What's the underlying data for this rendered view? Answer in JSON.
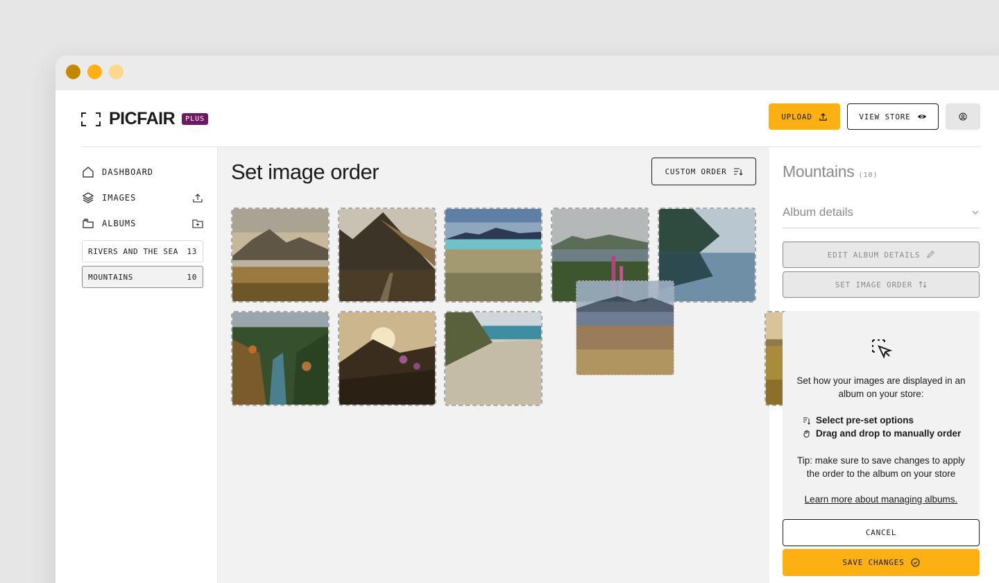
{
  "window": {
    "traffic_lights": [
      "#c48800",
      "#fdb013",
      "#fdd88a"
    ]
  },
  "brand": {
    "name": "PICFAIR",
    "badge": "PLUS",
    "badge_color": "#6d1a63",
    "accent": "#fdb013"
  },
  "header": {
    "upload_label": "UPLOAD",
    "view_store_label": "VIEW STORE"
  },
  "sidebar": {
    "nav": [
      {
        "label": "DASHBOARD",
        "icon": "home-icon"
      },
      {
        "label": "IMAGES",
        "icon": "layers-icon",
        "action_icon": "upload-icon"
      },
      {
        "label": "ALBUMS",
        "icon": "folder-icon",
        "action_icon": "folder-plus-icon"
      }
    ],
    "albums": [
      {
        "name": "RIVERS AND THE SEA",
        "count": "13",
        "active": false
      },
      {
        "name": "MOUNTAINS",
        "count": "10",
        "active": true
      }
    ]
  },
  "main": {
    "title": "Set image order",
    "order_button": "CUSTOM ORDER",
    "images": [
      "mountain-lake-highlands",
      "mountain-valley-path",
      "coastal-dunes-mountains",
      "foxgloves-lake",
      "forest-lake-reflection",
      "river-gorge-autumn",
      "sunset-rocks-flowers",
      "sand-dune-footprints",
      "golden-meadow",
      "dragged-moorland-mountains"
    ]
  },
  "panel": {
    "album_name": "Mountains",
    "album_count": "(10)",
    "details_label": "Album details",
    "edit_label": "EDIT ALBUM DETAILS",
    "set_order_label": "SET IMAGE ORDER",
    "help_intro": "Set how your images are displayed in an album on your store:",
    "option_1": "Select pre-set options",
    "option_2": "Drag and drop to manually order",
    "tip": "Tip: make sure to save changes to apply the order to the album on your store",
    "learn_more": "Learn more about managing albums.",
    "cancel_label": "CANCEL",
    "save_label": "SAVE CHANGES"
  }
}
